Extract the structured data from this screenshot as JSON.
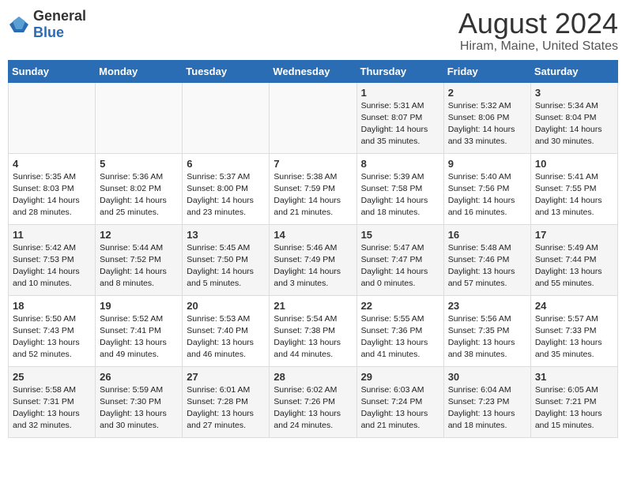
{
  "header": {
    "logo_general": "General",
    "logo_blue": "Blue",
    "title": "August 2024",
    "subtitle": "Hiram, Maine, United States"
  },
  "days_of_week": [
    "Sunday",
    "Monday",
    "Tuesday",
    "Wednesday",
    "Thursday",
    "Friday",
    "Saturday"
  ],
  "weeks": [
    [
      {
        "day": "",
        "text": ""
      },
      {
        "day": "",
        "text": ""
      },
      {
        "day": "",
        "text": ""
      },
      {
        "day": "",
        "text": ""
      },
      {
        "day": "1",
        "text": "Sunrise: 5:31 AM\nSunset: 8:07 PM\nDaylight: 14 hours\nand 35 minutes."
      },
      {
        "day": "2",
        "text": "Sunrise: 5:32 AM\nSunset: 8:06 PM\nDaylight: 14 hours\nand 33 minutes."
      },
      {
        "day": "3",
        "text": "Sunrise: 5:34 AM\nSunset: 8:04 PM\nDaylight: 14 hours\nand 30 minutes."
      }
    ],
    [
      {
        "day": "4",
        "text": "Sunrise: 5:35 AM\nSunset: 8:03 PM\nDaylight: 14 hours\nand 28 minutes."
      },
      {
        "day": "5",
        "text": "Sunrise: 5:36 AM\nSunset: 8:02 PM\nDaylight: 14 hours\nand 25 minutes."
      },
      {
        "day": "6",
        "text": "Sunrise: 5:37 AM\nSunset: 8:00 PM\nDaylight: 14 hours\nand 23 minutes."
      },
      {
        "day": "7",
        "text": "Sunrise: 5:38 AM\nSunset: 7:59 PM\nDaylight: 14 hours\nand 21 minutes."
      },
      {
        "day": "8",
        "text": "Sunrise: 5:39 AM\nSunset: 7:58 PM\nDaylight: 14 hours\nand 18 minutes."
      },
      {
        "day": "9",
        "text": "Sunrise: 5:40 AM\nSunset: 7:56 PM\nDaylight: 14 hours\nand 16 minutes."
      },
      {
        "day": "10",
        "text": "Sunrise: 5:41 AM\nSunset: 7:55 PM\nDaylight: 14 hours\nand 13 minutes."
      }
    ],
    [
      {
        "day": "11",
        "text": "Sunrise: 5:42 AM\nSunset: 7:53 PM\nDaylight: 14 hours\nand 10 minutes."
      },
      {
        "day": "12",
        "text": "Sunrise: 5:44 AM\nSunset: 7:52 PM\nDaylight: 14 hours\nand 8 minutes."
      },
      {
        "day": "13",
        "text": "Sunrise: 5:45 AM\nSunset: 7:50 PM\nDaylight: 14 hours\nand 5 minutes."
      },
      {
        "day": "14",
        "text": "Sunrise: 5:46 AM\nSunset: 7:49 PM\nDaylight: 14 hours\nand 3 minutes."
      },
      {
        "day": "15",
        "text": "Sunrise: 5:47 AM\nSunset: 7:47 PM\nDaylight: 14 hours\nand 0 minutes."
      },
      {
        "day": "16",
        "text": "Sunrise: 5:48 AM\nSunset: 7:46 PM\nDaylight: 13 hours\nand 57 minutes."
      },
      {
        "day": "17",
        "text": "Sunrise: 5:49 AM\nSunset: 7:44 PM\nDaylight: 13 hours\nand 55 minutes."
      }
    ],
    [
      {
        "day": "18",
        "text": "Sunrise: 5:50 AM\nSunset: 7:43 PM\nDaylight: 13 hours\nand 52 minutes."
      },
      {
        "day": "19",
        "text": "Sunrise: 5:52 AM\nSunset: 7:41 PM\nDaylight: 13 hours\nand 49 minutes."
      },
      {
        "day": "20",
        "text": "Sunrise: 5:53 AM\nSunset: 7:40 PM\nDaylight: 13 hours\nand 46 minutes."
      },
      {
        "day": "21",
        "text": "Sunrise: 5:54 AM\nSunset: 7:38 PM\nDaylight: 13 hours\nand 44 minutes."
      },
      {
        "day": "22",
        "text": "Sunrise: 5:55 AM\nSunset: 7:36 PM\nDaylight: 13 hours\nand 41 minutes."
      },
      {
        "day": "23",
        "text": "Sunrise: 5:56 AM\nSunset: 7:35 PM\nDaylight: 13 hours\nand 38 minutes."
      },
      {
        "day": "24",
        "text": "Sunrise: 5:57 AM\nSunset: 7:33 PM\nDaylight: 13 hours\nand 35 minutes."
      }
    ],
    [
      {
        "day": "25",
        "text": "Sunrise: 5:58 AM\nSunset: 7:31 PM\nDaylight: 13 hours\nand 32 minutes."
      },
      {
        "day": "26",
        "text": "Sunrise: 5:59 AM\nSunset: 7:30 PM\nDaylight: 13 hours\nand 30 minutes."
      },
      {
        "day": "27",
        "text": "Sunrise: 6:01 AM\nSunset: 7:28 PM\nDaylight: 13 hours\nand 27 minutes."
      },
      {
        "day": "28",
        "text": "Sunrise: 6:02 AM\nSunset: 7:26 PM\nDaylight: 13 hours\nand 24 minutes."
      },
      {
        "day": "29",
        "text": "Sunrise: 6:03 AM\nSunset: 7:24 PM\nDaylight: 13 hours\nand 21 minutes."
      },
      {
        "day": "30",
        "text": "Sunrise: 6:04 AM\nSunset: 7:23 PM\nDaylight: 13 hours\nand 18 minutes."
      },
      {
        "day": "31",
        "text": "Sunrise: 6:05 AM\nSunset: 7:21 PM\nDaylight: 13 hours\nand 15 minutes."
      }
    ]
  ]
}
